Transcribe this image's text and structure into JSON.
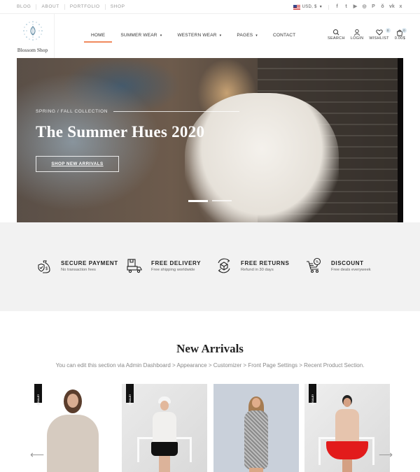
{
  "topbar": {
    "links": [
      "BLOG",
      "ABOUT",
      "PORTFOLIO",
      "SHOP"
    ],
    "currency": "USD, $",
    "social_icons": [
      "facebook-icon",
      "twitter-icon",
      "youtube-icon",
      "instagram-icon",
      "pinterest-icon",
      "odnoklassniki-icon",
      "vk-icon",
      "xing-icon"
    ],
    "social_glyphs": [
      "f",
      "t",
      "▶",
      "◎",
      "P",
      "ǒ",
      "vk",
      "x"
    ]
  },
  "header": {
    "logo_text": "Blossom Shop",
    "nav": [
      {
        "label": "HOME",
        "active": true,
        "dropdown": false
      },
      {
        "label": "SUMMER WEAR",
        "active": false,
        "dropdown": true
      },
      {
        "label": "WESTERN WEAR",
        "active": false,
        "dropdown": true
      },
      {
        "label": "PAGES",
        "active": false,
        "dropdown": true
      },
      {
        "label": "CONTACT",
        "active": false,
        "dropdown": false
      }
    ],
    "dropdown_glyph": "▾",
    "actions": {
      "search": "SEARCH",
      "login": "LOGIN",
      "wishlist": "WISHLIST",
      "wishlist_count": "0",
      "cart": "0.00$",
      "cart_count": "0"
    },
    "accent_color": "#f08a5d"
  },
  "hero": {
    "kicker": "SPRING / FALL COLLECTION",
    "title": "The Summer Hues 2020",
    "button": "SHOP NEW ARRIVALS",
    "slides": 2,
    "active_slide": 1
  },
  "features": [
    {
      "title": "SECURE PAYMENT",
      "subtitle": "No transaction fees",
      "icon": "money-bag-shield-icon"
    },
    {
      "title": "FREE DELIVERY",
      "subtitle": "Free shipping worldwide",
      "icon": "delivery-truck-icon"
    },
    {
      "title": "FREE RETURNS",
      "subtitle": "Refund in 30 days",
      "icon": "return-box-icon"
    },
    {
      "title": "DISCOUNT",
      "subtitle": "Free deals everyweek",
      "icon": "discount-cart-icon"
    }
  ],
  "new_arrivals": {
    "title": "New Arrivals",
    "subtitle": "You can edit this section via Admin Dashboard > Appearance > Customizer > Front Page Settings > Recent Product Section.",
    "sale_label": "SALE!",
    "products": [
      {
        "sale": true,
        "desc": "Woman in beige knit sweater"
      },
      {
        "sale": true,
        "desc": "Woman in white top and black skirt with hat"
      },
      {
        "sale": false,
        "desc": "Woman in grey patterned bodycon dress"
      },
      {
        "sale": true,
        "desc": "Woman in beige top and red skirt"
      }
    ],
    "prev_arrow": "⟵",
    "next_arrow": "⟶"
  }
}
